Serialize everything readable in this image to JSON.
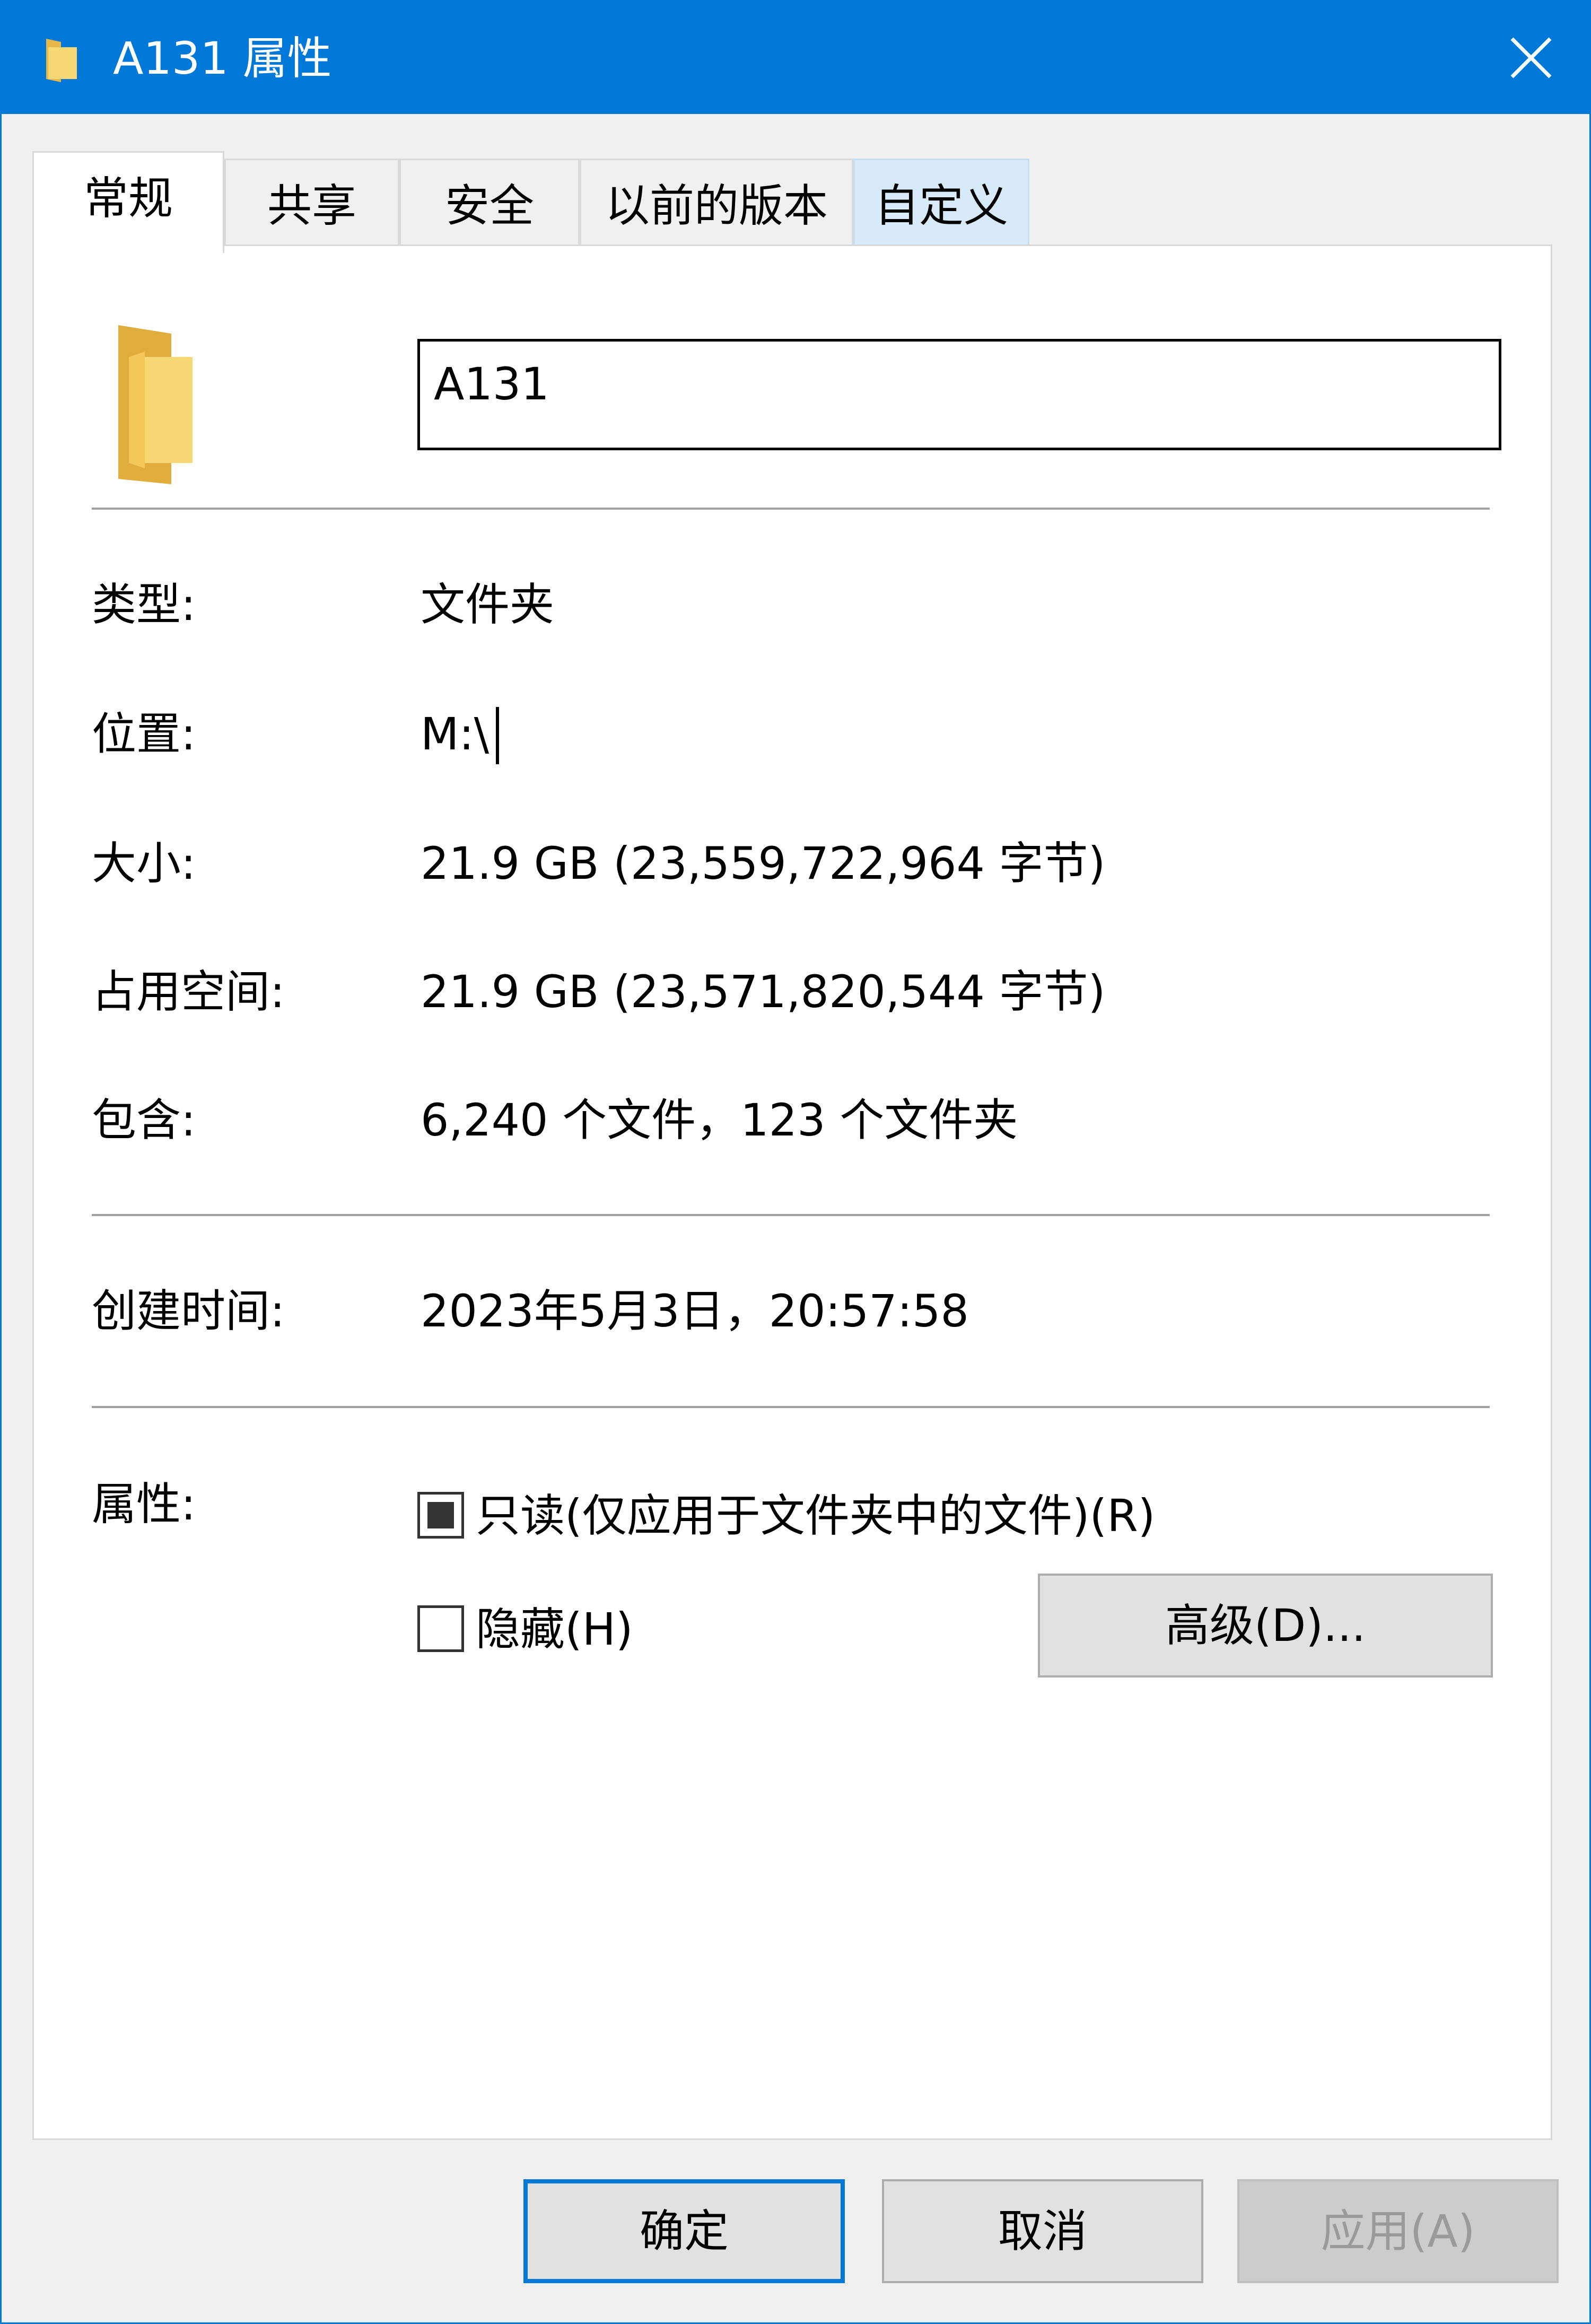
{
  "window": {
    "title": "A131 属性"
  },
  "tabs": [
    {
      "label": "常规"
    },
    {
      "label": "共享"
    },
    {
      "label": "安全"
    },
    {
      "label": "以前的版本"
    },
    {
      "label": "自定义"
    }
  ],
  "general": {
    "name_value": "A131",
    "type_label": "类型:",
    "type_value": "文件夹",
    "location_label": "位置:",
    "location_value": "M:\\",
    "size_label": "大小:",
    "size_value": "21.9 GB (23,559,722,964 字节)",
    "size_on_disk_label": "占用空间:",
    "size_on_disk_value": "21.9 GB (23,571,820,544 字节)",
    "contains_label": "包含:",
    "contains_value": "6,240 个文件，123 个文件夹",
    "created_label": "创建时间:",
    "created_value": "2023年5月3日，20:57:58",
    "attributes_label": "属性:",
    "readonly_label": "只读(仅应用于文件夹中的文件)(R)",
    "readonly_state": "indeterminate",
    "hidden_label": "隐藏(H)",
    "hidden_checked": false,
    "advanced_button": "高级(D)..."
  },
  "footer": {
    "ok_button": "确定",
    "cancel_button": "取消",
    "apply_button": "应用(A)"
  },
  "colors": {
    "titlebar": "#0078d7",
    "folder_yellow": "#f8d775",
    "default_button_border": "#0078d7"
  }
}
